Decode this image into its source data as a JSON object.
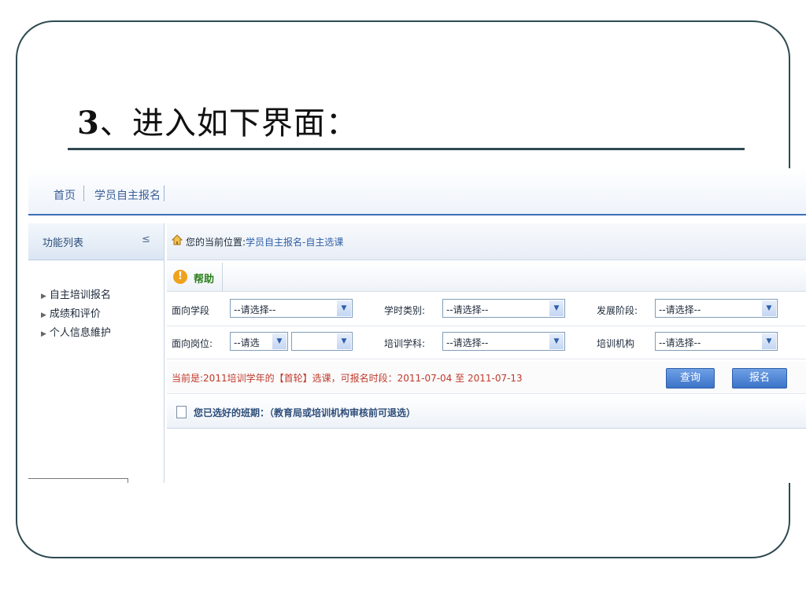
{
  "slide": {
    "title_number": "3",
    "title_text": "、进入如下界面："
  },
  "nav": {
    "tabs": [
      "首页",
      "学员自主报名"
    ]
  },
  "sidebar": {
    "header": "功能列表",
    "collapse_icon": "double-chevron-down-icon",
    "items": [
      {
        "label": "自主培训报名"
      },
      {
        "label": "成绩和评价"
      },
      {
        "label": "个人信息維护"
      }
    ]
  },
  "location": {
    "label": "您的当前位置:",
    "path": "学员自主报名-自主选课"
  },
  "help": {
    "icon": "warning-icon",
    "label": "帮助"
  },
  "filters": {
    "row1": [
      {
        "label": "面向学段",
        "value": "--请选择--"
      },
      {
        "label": "学时类别:",
        "value": "--请选择--"
      },
      {
        "label": "发展阶段:",
        "value": "--请选择--"
      }
    ],
    "row2": [
      {
        "label": "面向岗位:",
        "value": "--请选",
        "value2": ""
      },
      {
        "label": "培训学科:",
        "value": "--请选择--"
      },
      {
        "label": "培训机构",
        "value": "--请选择--"
      }
    ]
  },
  "notice": {
    "text": "当前是:2011培训学年的【首轮】选课，可报名时段：2011-07-04 至 2011-07-13"
  },
  "actions": {
    "query": "查询",
    "register": "报名"
  },
  "selected": {
    "icon": "document-icon",
    "label": "您已选好的班期：（教育局或培训机构审核前可退选）"
  }
}
